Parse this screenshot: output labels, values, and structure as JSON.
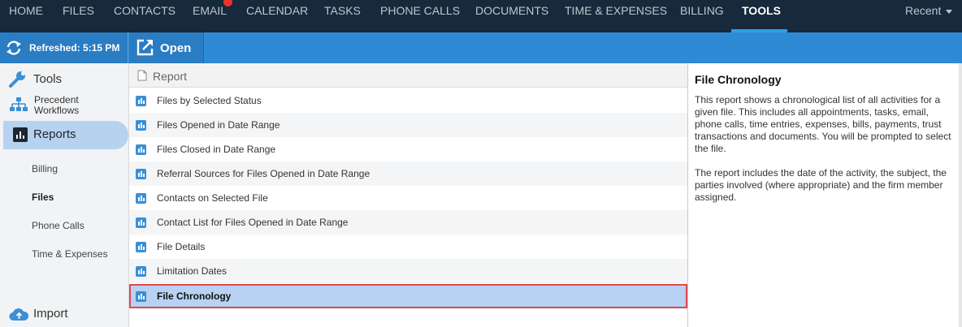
{
  "nav": {
    "items": [
      {
        "label": "HOME",
        "active": false
      },
      {
        "label": "FILES",
        "active": false
      },
      {
        "label": "CONTACTS",
        "active": false
      },
      {
        "label": "EMAIL",
        "active": false
      },
      {
        "label": "CALENDAR",
        "active": false
      },
      {
        "label": "TASKS",
        "active": false
      },
      {
        "label": "PHONE CALLS",
        "active": false
      },
      {
        "label": "DOCUMENTS",
        "active": false
      },
      {
        "label": "TIME & EXPENSES",
        "active": false
      },
      {
        "label": "BILLING",
        "active": false
      },
      {
        "label": "TOOLS",
        "active": true
      }
    ],
    "recent": "Recent"
  },
  "toolbar": {
    "refresh": "Refreshed: 5:15 PM",
    "open": "Open"
  },
  "sidebar": {
    "tools": "Tools",
    "precedent_line1": "Precedent",
    "precedent_line2": "Workflows",
    "reports": "Reports",
    "sub_items": [
      {
        "label": "Billing",
        "active": false
      },
      {
        "label": "Files",
        "active": true
      },
      {
        "label": "Phone Calls",
        "active": false
      },
      {
        "label": "Time & Expenses",
        "active": false
      }
    ],
    "import": "Import"
  },
  "report_list": {
    "header": "Report",
    "rows": [
      {
        "label": "Files by Selected Status"
      },
      {
        "label": "Files Opened in Date Range"
      },
      {
        "label": "Files Closed in Date Range"
      },
      {
        "label": "Referral Sources for Files Opened in Date Range"
      },
      {
        "label": "Contacts on Selected File"
      },
      {
        "label": "Contact List for Files Opened in Date Range"
      },
      {
        "label": "File Details"
      },
      {
        "label": "Limitation Dates"
      },
      {
        "label": "File Chronology",
        "selected": true
      }
    ]
  },
  "detail": {
    "title": "File Chronology",
    "paragraph1": "This report shows a chronological list of all activities for a given file. This includes all appointments, tasks, email, phone calls, time entries, expenses, bills, payments, trust transactions and documents. You will be prompted to select the file.",
    "paragraph2": "The report includes the date of the activity, the subject, the parties involved (where appropriate) and the firm member assigned."
  },
  "colors": {
    "nav_bg": "#162a3b",
    "toolbar_bg": "#2f8ad6",
    "selection_bg": "#b7d2f2",
    "selection_border": "#e0474c",
    "badge": "#e8342f"
  }
}
